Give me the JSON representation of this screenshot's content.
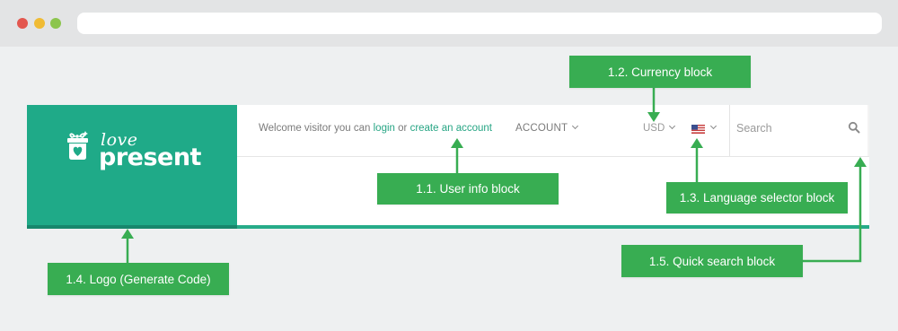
{
  "browser": {
    "window_controls": [
      "close",
      "minimize",
      "maximize"
    ]
  },
  "header": {
    "logo": {
      "line1": "love",
      "line2": "present",
      "icon": "gift-box-heart-icon"
    },
    "user_info": {
      "prefix": "Welcome visitor you can ",
      "login_label": "login",
      "middle": " or ",
      "create_account_label": "create an account"
    },
    "account_menu_label": "ACCOUNT",
    "currency_label": "USD",
    "language": {
      "flag": "us-flag-icon"
    },
    "search": {
      "placeholder": "Search",
      "icon": "search-icon"
    }
  },
  "callouts": {
    "user_info": "1.1. User info block",
    "currency": "1.2. Currency block",
    "language": "1.3. Language selector block",
    "logo": "1.4. Logo (Generate Code)",
    "search": "1.5. Quick search block"
  },
  "colors": {
    "brand_green": "#1faa88",
    "callout_green": "#38ad52",
    "link": "#27a584",
    "page_bg": "#eef0f1"
  }
}
